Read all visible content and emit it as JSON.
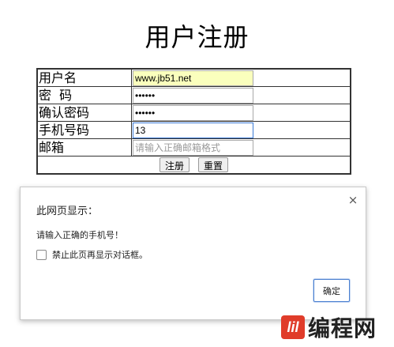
{
  "page": {
    "title": "用户注册"
  },
  "form": {
    "username": {
      "label": "用户名",
      "value": "www.jb51.net"
    },
    "password": {
      "label": "密  码",
      "value": "123456"
    },
    "confirm": {
      "label": "确认密码",
      "value": "123456"
    },
    "phone": {
      "label": "手机号码",
      "value": "13"
    },
    "email": {
      "label": "邮箱",
      "placeholder": "请输入正确邮箱格式"
    },
    "submit_label": "注册",
    "reset_label": "重置"
  },
  "dialog": {
    "title": "此网页显示：",
    "message": "请输入正确的手机号！",
    "checkbox_label": "禁止此页再显示对话框。",
    "ok_label": "确定",
    "close_glyph": "×"
  },
  "watermark": {
    "mark": "lil",
    "text": "编程网"
  },
  "colors": {
    "autofill": "#faffbd",
    "focus": "#3c7bd6",
    "logo": "#e03c2a"
  }
}
